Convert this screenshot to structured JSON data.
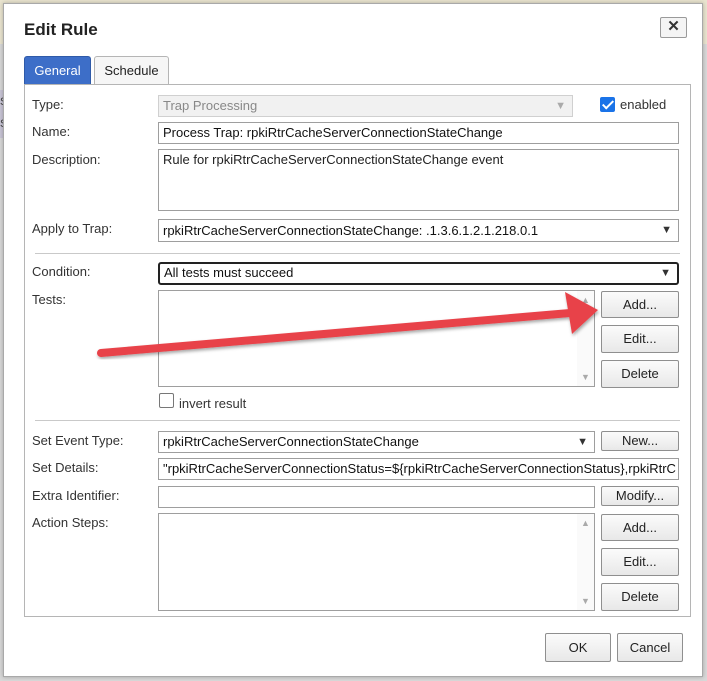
{
  "dialog": {
    "title": "Edit Rule"
  },
  "tabs": [
    {
      "label": "General"
    },
    {
      "label": "Schedule"
    }
  ],
  "background": {
    "side_text_1": "Se",
    "side_text_2": "Se"
  },
  "form": {
    "type_label": "Type:",
    "type_value": "Trap Processing",
    "enabled_label": "enabled",
    "name_label": "Name:",
    "name_value": "Process Trap: rpkiRtrCacheServerConnectionStateChange",
    "description_label": "Description:",
    "description_value": "Rule for rpkiRtrCacheServerConnectionStateChange event",
    "apply_label": "Apply to Trap:",
    "apply_value": "rpkiRtrCacheServerConnectionStateChange: .1.3.6.1.2.1.218.0.1",
    "condition_label": "Condition:",
    "condition_value": "All tests must succeed",
    "tests_label": "Tests:",
    "tests_add": "Add...",
    "tests_edit": "Edit...",
    "tests_delete": "Delete",
    "invert_label": "invert result",
    "event_type_label": "Set Event Type:",
    "event_type_value": "rpkiRtrCacheServerConnectionStateChange",
    "event_new": "New...",
    "details_label": "Set Details:",
    "details_value": "\"rpkiRtrCacheServerConnectionStatus=${rpkiRtrCacheServerConnectionStatus},rpkiRtrC",
    "extra_label": "Extra Identifier:",
    "extra_value": "",
    "extra_modify": "Modify...",
    "steps_label": "Action Steps:",
    "steps_add": "Add...",
    "steps_edit": "Edit...",
    "steps_delete": "Delete"
  },
  "footer": {
    "ok": "OK",
    "cancel": "Cancel"
  },
  "colors": {
    "tab_active": "#3d6ec8",
    "annotation_arrow": "#e8434a",
    "checkbox": "#1a73e8"
  }
}
